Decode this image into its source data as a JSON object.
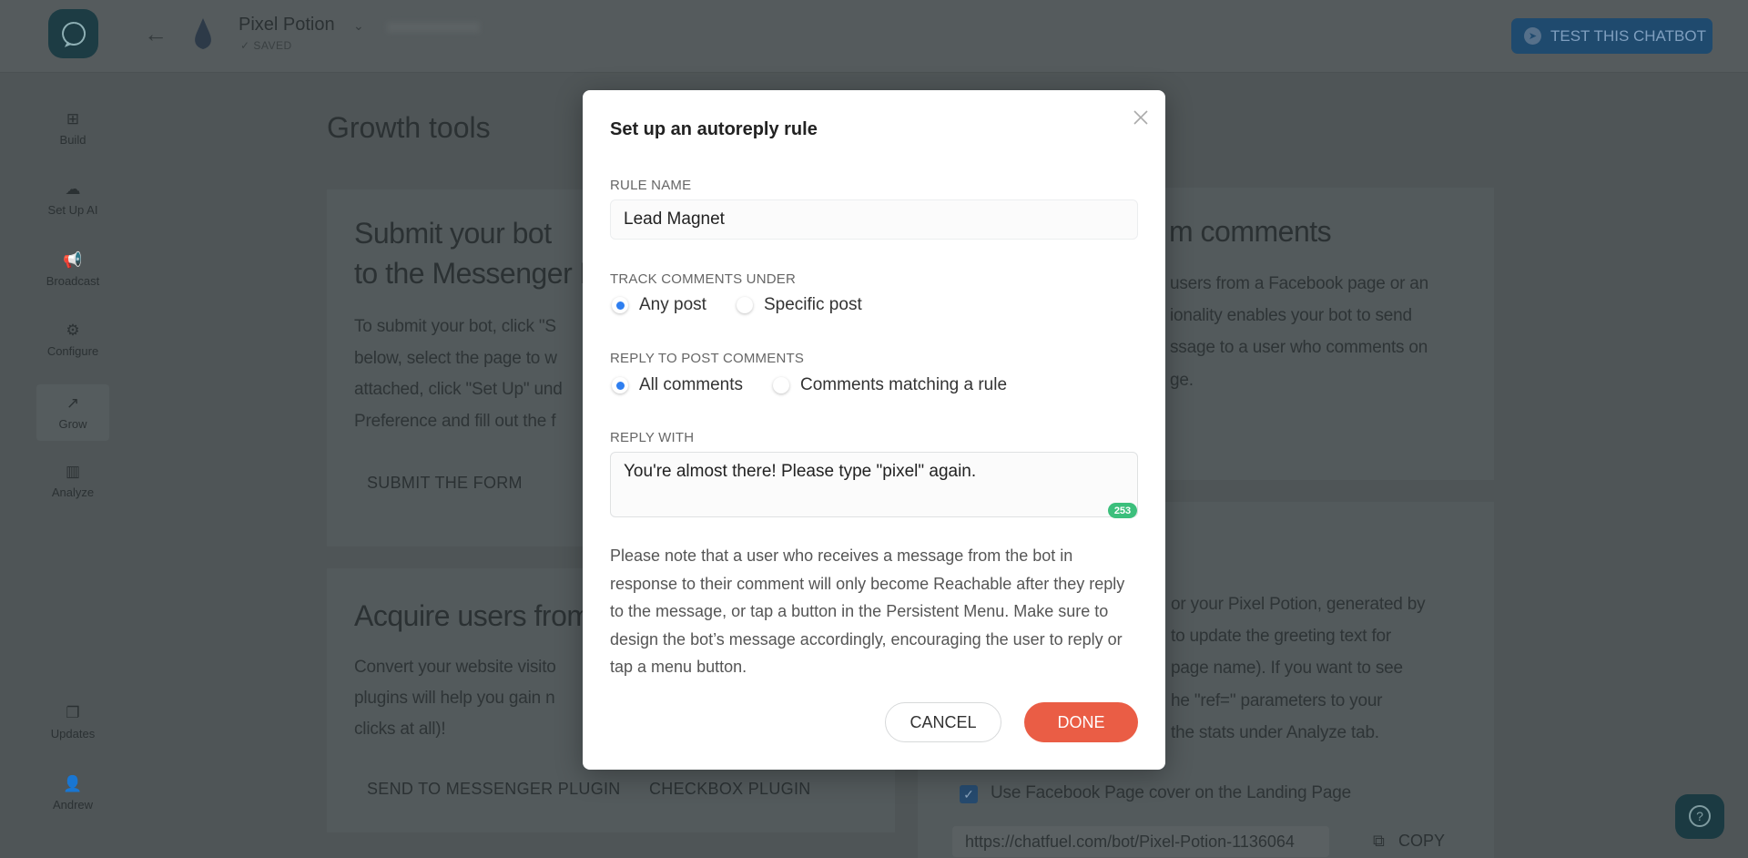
{
  "header": {
    "bot_name": "Pixel Potion",
    "save_status": "✓ SAVED",
    "test_button": "TEST THIS CHATBOT"
  },
  "sidebar": {
    "items": [
      {
        "label": "Build",
        "icon": "grid-icon",
        "glyph": "⊞"
      },
      {
        "label": "Set Up AI",
        "icon": "ai-cloud-icon",
        "glyph": "☁"
      },
      {
        "label": "Broadcast",
        "icon": "megaphone-icon",
        "glyph": "📢"
      },
      {
        "label": "Configure",
        "icon": "gear-icon",
        "glyph": "⚙"
      },
      {
        "label": "Grow",
        "icon": "growth-icon",
        "glyph": "↗",
        "active": true
      },
      {
        "label": "Analyze",
        "icon": "bar-chart-icon",
        "glyph": "▥"
      }
    ],
    "bottom": [
      {
        "label": "Updates",
        "icon": "updates-icon",
        "glyph": "❐"
      },
      {
        "label": "Andrew",
        "icon": "user-avatar",
        "glyph": "👤"
      }
    ]
  },
  "page": {
    "title": "Growth tools",
    "card_submit": {
      "title_lines": [
        "Submit your bot",
        "to the Messenger D"
      ],
      "body_lines": [
        "To submit your bot, click \"S",
        "below, select the page to w",
        "attached, click \"Set Up\" und",
        "Preference and fill out the f"
      ],
      "button": "SUBMIT THE FORM"
    },
    "card_acquire_web": {
      "title": "Acquire users from",
      "body_lines": [
        "Convert your website visito",
        "plugins will help you gain n",
        "clicks at all)!"
      ],
      "buttons": [
        "SEND TO MESSENGER PLUGIN",
        "CHECKBOX PLUGIN"
      ]
    },
    "card_comments": {
      "title": "m comments",
      "body_lines": [
        "users from a Facebook page or an",
        "ionality enables your bot to send",
        "ssage to a user who comments on",
        "ge."
      ]
    },
    "card_landing": {
      "body_lines": [
        "or your Pixel Potion, generated by",
        "to update the greeting text for",
        "page name). If you want to see",
        "he \"ref=\" parameters to your",
        "the stats under Analyze tab."
      ],
      "checkbox_label": "Use Facebook Page cover on the Landing Page",
      "checkbox_checked": true,
      "url": "https://chatfuel.com/bot/Pixel-Potion-1136064",
      "copy_label": "COPY"
    }
  },
  "modal": {
    "title": "Set up an autoreply rule",
    "rule_name_label": "RULE NAME",
    "rule_name_value": "Lead Magnet",
    "track_label": "TRACK COMMENTS UNDER",
    "track_options": [
      "Any post",
      "Specific post"
    ],
    "track_selected": "Any post",
    "reply_to_label": "REPLY TO POST COMMENTS",
    "reply_to_options": [
      "All comments",
      "Comments matching a rule"
    ],
    "reply_to_selected": "All comments",
    "reply_with_label": "REPLY WITH",
    "reply_with_value": "You're almost there! Please type \"pixel\" again.",
    "char_counter": "253",
    "note": "Please note that a user who receives a message from the bot in response to their comment will only become Reachable after they reply to the message, or tap a button in the Persistent Menu. Make sure to design the bot’s message accordingly, encouraging the user to reply or tap a menu button.",
    "cancel_label": "CANCEL",
    "done_label": "DONE"
  },
  "colors": {
    "accent_done": "#ea5d45",
    "radio_selected": "#2f7ff0",
    "counter_green": "#3cbf7c",
    "test_button": "#1f7fdb"
  }
}
